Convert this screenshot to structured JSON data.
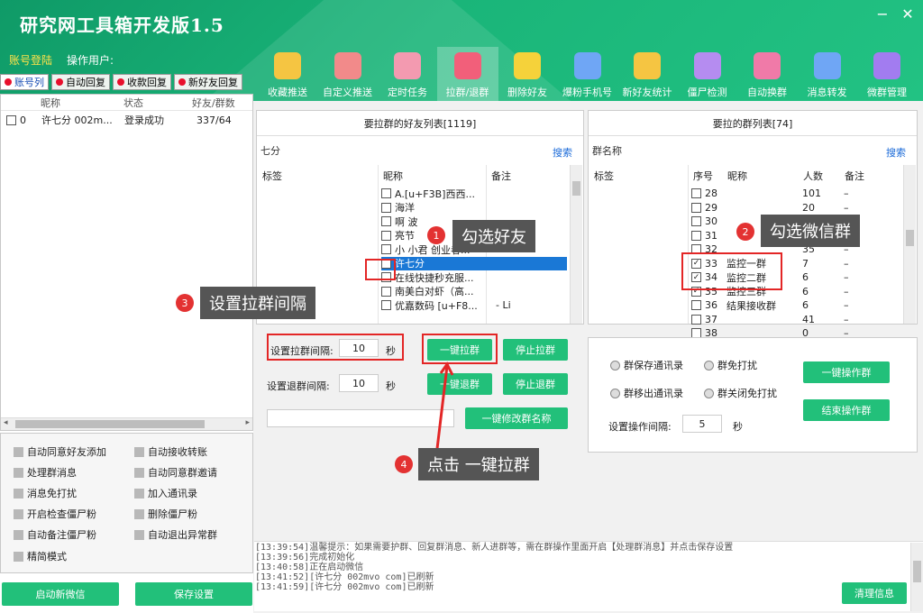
{
  "window": {
    "title": "研究网工具箱开发版1.5",
    "min": "−",
    "close": "✕"
  },
  "login": {
    "label": "账号登陆",
    "operator": "操作用户:"
  },
  "left_tabs": [
    "账号列",
    "自动回复",
    "收款回复",
    "新好友回复"
  ],
  "accounts": {
    "headers": [
      "昵称",
      "状态",
      "好友/群数"
    ],
    "rows": [
      {
        "idx": "0",
        "name": "许七分 002m...",
        "status": "登录成功",
        "count": "337/64"
      }
    ]
  },
  "toolbar": [
    {
      "label": "收藏推送",
      "icon": "folder-star-icon",
      "color": "#f5c542"
    },
    {
      "label": "自定义推送",
      "icon": "document-icon",
      "color": "#f28a8a"
    },
    {
      "label": "定时任务",
      "icon": "coffee-cup-icon",
      "color": "#f39ab0"
    },
    {
      "label": "拉群/退群",
      "icon": "bell-icon",
      "color": "#f25f7a"
    },
    {
      "label": "删除好友",
      "icon": "trash-icon",
      "color": "#f5d23a"
    },
    {
      "label": "爆粉手机号",
      "icon": "phone-icon",
      "color": "#6fa6f5"
    },
    {
      "label": "新好友统计",
      "icon": "user-icon",
      "color": "#f5c542"
    },
    {
      "label": "僵尸检测",
      "icon": "magnifier-icon",
      "color": "#b58cf0"
    },
    {
      "label": "自动换群",
      "icon": "monitor-icon",
      "color": "#f07aa8"
    },
    {
      "label": "消息转发",
      "icon": "message-icon",
      "color": "#6fa6f5"
    },
    {
      "label": "微群管理",
      "icon": "gear-icon",
      "color": "#a27cf0"
    }
  ],
  "friends_panel": {
    "title": "要拉群的好友列表[1119]",
    "filter": "七分",
    "search": "搜索",
    "headers": [
      "标签",
      "昵称",
      "备注"
    ],
    "rows": [
      {
        "name": "A.[u+F3B]西西...",
        "note": "",
        "checked": false
      },
      {
        "name": "海洋",
        "note": "",
        "checked": false
      },
      {
        "name": "啊  波",
        "note": "",
        "checked": false
      },
      {
        "name": "亮节",
        "note": "",
        "checked": false
      },
      {
        "name": "小 小君 创业者...",
        "note": "",
        "checked": false
      },
      {
        "name": "许七分",
        "note": "",
        "checked": true
      },
      {
        "name": "在线快捷秒充服...",
        "note": "",
        "checked": false
      },
      {
        "name": "南美白对虾（高...",
        "note": "",
        "checked": false
      },
      {
        "name": "优嘉数码 [u+F8...",
        "note": "- Li",
        "checked": false
      }
    ]
  },
  "groups_panel": {
    "title": "要拉的群列表[74]",
    "filter": "群名称",
    "search": "搜索",
    "headers": [
      "标签",
      "序号",
      "昵称",
      "人数",
      "备注"
    ],
    "rows": [
      {
        "no": "28",
        "name": "",
        "count": "101",
        "note": "–",
        "checked": false
      },
      {
        "no": "29",
        "name": "",
        "count": "20",
        "note": "–",
        "checked": false
      },
      {
        "no": "30",
        "name": "",
        "count": "60",
        "note": "–",
        "checked": false
      },
      {
        "no": "31",
        "name": "",
        "count": "8",
        "note": "–",
        "checked": false
      },
      {
        "no": "32",
        "name": "",
        "count": "35",
        "note": "–",
        "checked": false
      },
      {
        "no": "33",
        "name": "监控一群",
        "count": "7",
        "note": "–",
        "checked": true
      },
      {
        "no": "34",
        "name": "监控二群",
        "count": "6",
        "note": "–",
        "checked": true
      },
      {
        "no": "35",
        "name": "监控三群",
        "count": "6",
        "note": "–",
        "checked": true
      },
      {
        "no": "36",
        "name": "结果接收群",
        "count": "6",
        "note": "–",
        "checked": false
      },
      {
        "no": "37",
        "name": "",
        "count": "41",
        "note": "–",
        "checked": false
      },
      {
        "no": "38",
        "name": "",
        "count": "0",
        "note": "–",
        "checked": false
      }
    ]
  },
  "pull": {
    "interval_label": "设置拉群间隔:",
    "interval": "10",
    "unit": "秒",
    "quit_label": "设置退群间隔:",
    "quit_interval": "10",
    "btn_pull": "一键拉群",
    "btn_stop_pull": "停止拉群",
    "btn_quit": "一键退群",
    "btn_stop_quit": "停止退群",
    "btn_rename": "一键修改群名称"
  },
  "groupops": {
    "r1": "群保存通讯录",
    "r2": "群免打扰",
    "r3": "群移出通讯录",
    "r4": "群关闭免打扰",
    "interval_label": "设置操作间隔:",
    "interval": "5",
    "unit": "秒",
    "btn_op": "一键操作群",
    "btn_end": "结束操作群"
  },
  "options": [
    "自动同意好友添加",
    "自动接收转账",
    "处理群消息",
    "自动同意群邀请",
    "消息免打扰",
    "加入通讯录",
    "开启检查僵尸粉",
    "删除僵尸粉",
    "自动备注僵尸粉",
    "自动退出异常群",
    "精简模式"
  ],
  "bottom": {
    "start": "启动新微信",
    "save": "保存设置",
    "clear": "清理信息"
  },
  "log": [
    "[13:39:54]温馨提示：如果需要护群、回复群消息、新人进群等，需在群操作里面开启【处理群消息】并点击保存设置",
    "[13:39:56]完成初始化",
    "[13:40:58]正在启动微信",
    "[13:41:52][许七分 002mvo com]已刷新",
    "[13:41:59][许七分 002mvo com]已刷新"
  ],
  "callouts": [
    {
      "num": "1",
      "text": "勾选好友"
    },
    {
      "num": "2",
      "text": "勾选微信群"
    },
    {
      "num": "3",
      "text": "设置拉群间隔"
    },
    {
      "num": "4",
      "text": "点击 一键拉群"
    }
  ]
}
